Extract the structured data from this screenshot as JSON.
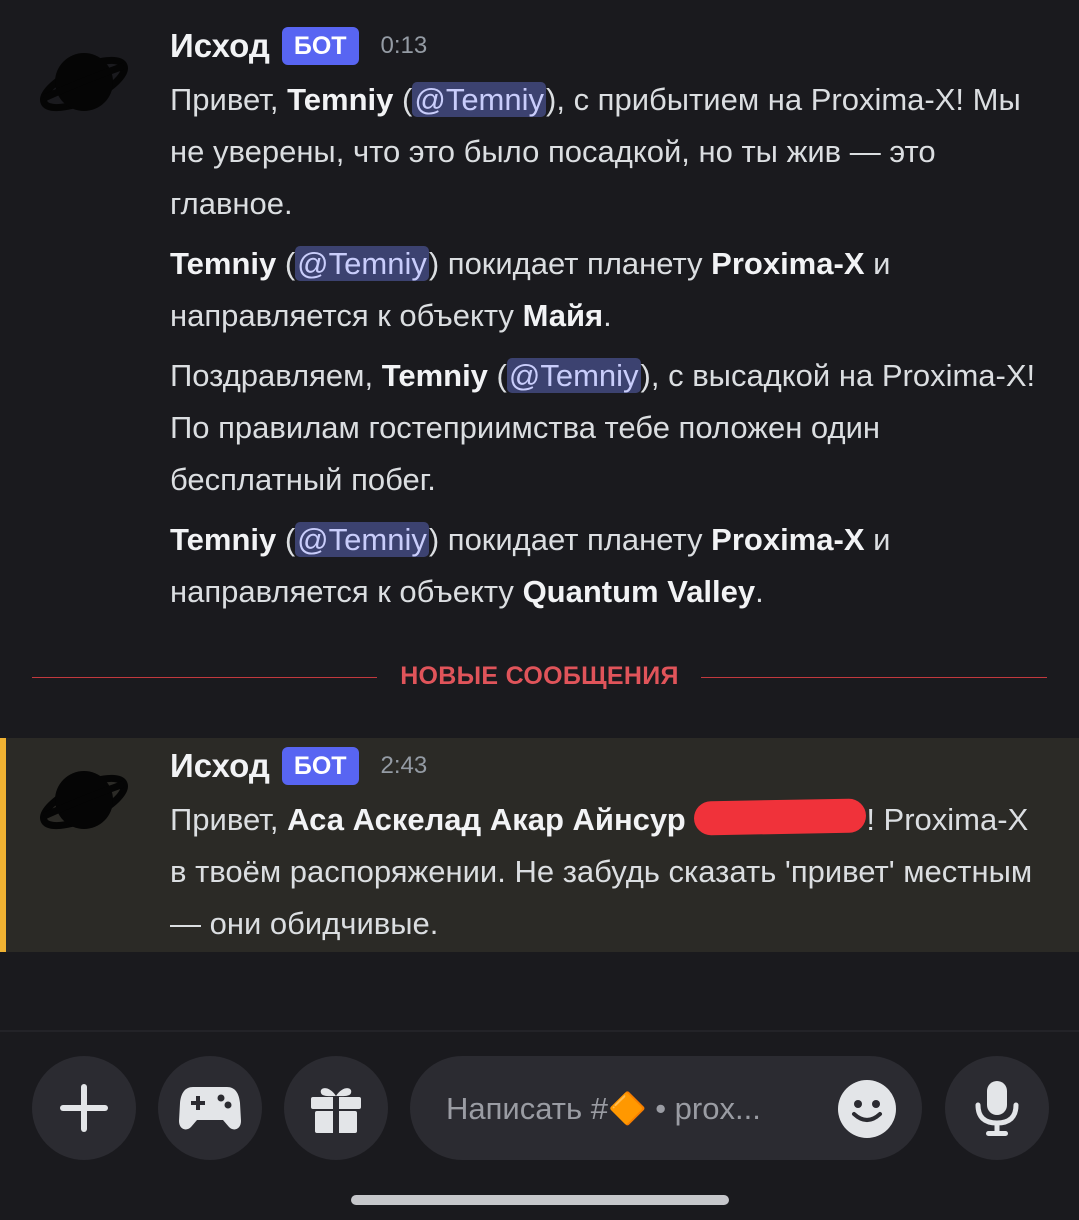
{
  "messages": [
    {
      "author": "Исход",
      "bot_tag": "БОТ",
      "time": "0:13",
      "avatar_icon": "planet-icon",
      "paragraphs": [
        {
          "p1": "Привет, ",
          "name": "Temniy",
          "open": " (",
          "mention": "@Temniy",
          "p2": "), с прибытием на Proxima-X! Мы не уверены, что это было посадкой, но ты жив — это главное."
        },
        {
          "name": "Temniy",
          "open": " (",
          "mention": "@Temniy",
          "p2": ") покидает планету ",
          "planet": "Proxima-X",
          "p3": " и направляется к объекту ",
          "target": "Майя",
          "end": "."
        },
        {
          "p1": "Поздравляем, ",
          "name": "Temniy",
          "open": " (",
          "mention": "@Temniy",
          "p2": "), с высадкой на Proxima-X! По правилам гостеприимства тебе положен один бесплатный побег."
        },
        {
          "name": "Temniy",
          "open": " (",
          "mention": "@Temniy",
          "p2": ") покидает планету ",
          "planet": "Proxima-X",
          "p3": " и направляется к объекту ",
          "target": "Quantum Valley",
          "end": "."
        }
      ]
    },
    {
      "author": "Исход",
      "bot_tag": "БОТ",
      "time": "2:43",
      "avatar_icon": "planet-icon",
      "paragraphs": [
        {
          "p1": "Привет, ",
          "name": "Аса Аскелад Акар Айнсур",
          "open": " ",
          "p2": "! Proxima-X в твоём распоряжении. Не забудь сказать 'привет' местным — они обидчивые."
        }
      ]
    }
  ],
  "divider": {
    "label": "НОВЫЕ СООБЩЕНИЯ",
    "color": "#e0545a"
  },
  "composer": {
    "placeholder": "Написать #🔶 • prox...",
    "buttons": [
      "plus-icon",
      "gamepad-icon",
      "gift-icon",
      "emoji-icon",
      "microphone-icon"
    ]
  },
  "colors": {
    "background": "#1a1a1e",
    "bot_tag": "#5865f2",
    "mention_bg": "#3c4270",
    "highlight_bar": "#f0b232",
    "highlight_bg": "#2b2a26"
  }
}
